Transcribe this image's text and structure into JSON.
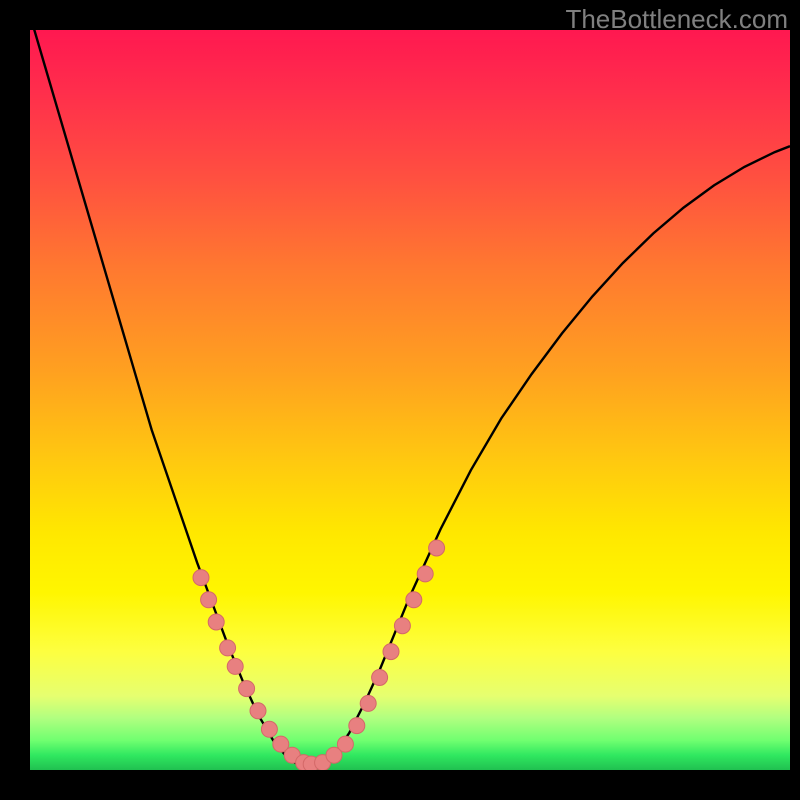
{
  "watermark": "TheBottleneck.com",
  "colors": {
    "frame_bg": "#000000",
    "watermark_text": "#808080",
    "curve_stroke": "#000000",
    "dot_fill": "#e88080",
    "dot_stroke": "#d46868"
  },
  "chart_data": {
    "type": "line",
    "title": "",
    "xlabel": "",
    "ylabel": "",
    "xlim": [
      0,
      100
    ],
    "ylim": [
      0,
      100
    ],
    "curve_x": [
      0,
      2,
      4,
      6,
      8,
      10,
      12,
      14,
      16,
      18,
      20,
      22,
      24,
      26,
      28,
      30,
      32,
      34,
      36,
      38,
      40,
      42,
      44,
      46,
      48,
      50,
      54,
      58,
      62,
      66,
      70,
      74,
      78,
      82,
      86,
      90,
      94,
      98,
      100
    ],
    "curve_y": [
      102,
      95,
      88,
      81,
      74,
      67,
      60,
      53,
      46,
      40,
      34,
      28,
      22.5,
      17,
      12,
      7.5,
      4,
      1.5,
      0.3,
      0.5,
      2,
      5,
      9,
      13.5,
      18.5,
      23.5,
      32.5,
      40.5,
      47.5,
      53.5,
      59,
      64,
      68.5,
      72.5,
      76,
      79,
      81.5,
      83.5,
      84.3
    ],
    "valley_x": 36.5,
    "notes": "V-shaped bottleneck curve; minimum (optimal match) near x≈36; left branch steeper than right; dot clusters highlight the regions near the minimum on both branches.",
    "dot_clusters": {
      "left_branch": [
        {
          "x": 22.5,
          "y": 26
        },
        {
          "x": 23.5,
          "y": 23
        },
        {
          "x": 24.5,
          "y": 20
        },
        {
          "x": 26,
          "y": 16.5
        },
        {
          "x": 27,
          "y": 14
        },
        {
          "x": 28.5,
          "y": 11
        },
        {
          "x": 30,
          "y": 8
        },
        {
          "x": 31.5,
          "y": 5.5
        },
        {
          "x": 33,
          "y": 3.5
        },
        {
          "x": 34.5,
          "y": 2
        }
      ],
      "valley": [
        {
          "x": 36,
          "y": 1
        },
        {
          "x": 37,
          "y": 0.8
        },
        {
          "x": 38.5,
          "y": 1
        },
        {
          "x": 40,
          "y": 2
        },
        {
          "x": 41.5,
          "y": 3.5
        }
      ],
      "right_branch": [
        {
          "x": 43,
          "y": 6
        },
        {
          "x": 44.5,
          "y": 9
        },
        {
          "x": 46,
          "y": 12.5
        },
        {
          "x": 47.5,
          "y": 16
        },
        {
          "x": 49,
          "y": 19.5
        },
        {
          "x": 50.5,
          "y": 23
        },
        {
          "x": 52,
          "y": 26.5
        },
        {
          "x": 53.5,
          "y": 30
        }
      ]
    }
  }
}
